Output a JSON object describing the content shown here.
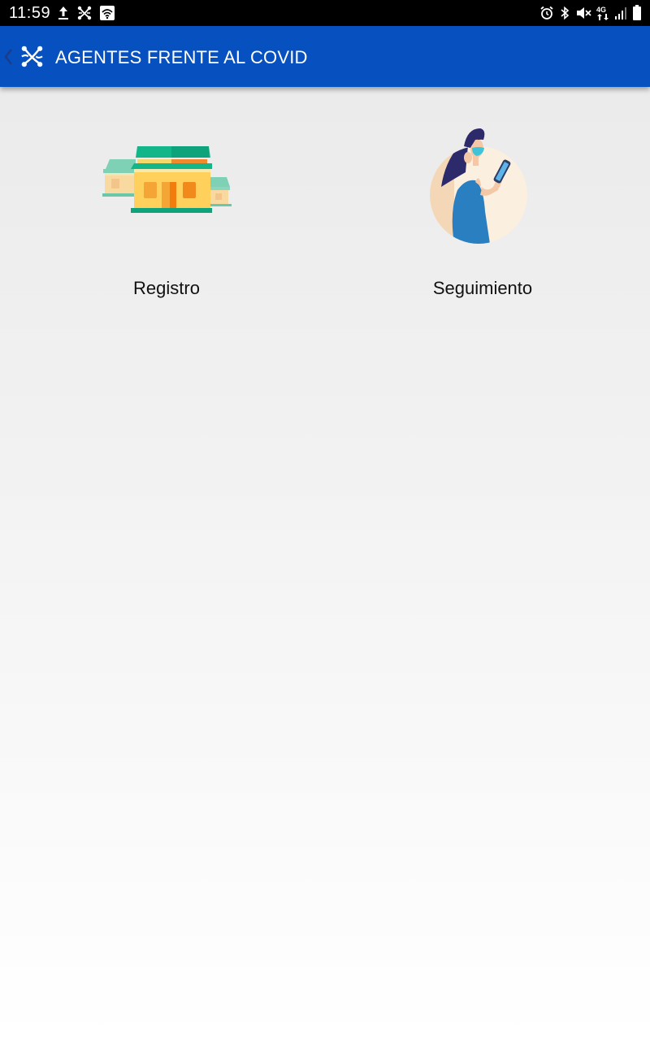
{
  "status_bar": {
    "time": "11:59",
    "left_icons": [
      "upload-icon",
      "app-logo-notification-icon",
      "wifi-notification-icon"
    ],
    "right_icons": [
      "alarm-icon",
      "bluetooth-icon",
      "mute-icon",
      "network-4g-icon",
      "signal-icon",
      "battery-icon"
    ],
    "network_label": "4G"
  },
  "app_bar": {
    "title": "AGENTES FRENTE AL COVID",
    "background_color": "#0750bf"
  },
  "menu": {
    "items": [
      {
        "label": "Registro",
        "icon": "houses-illustration"
      },
      {
        "label": "Seguimiento",
        "icon": "woman-phone-illustration"
      }
    ]
  }
}
